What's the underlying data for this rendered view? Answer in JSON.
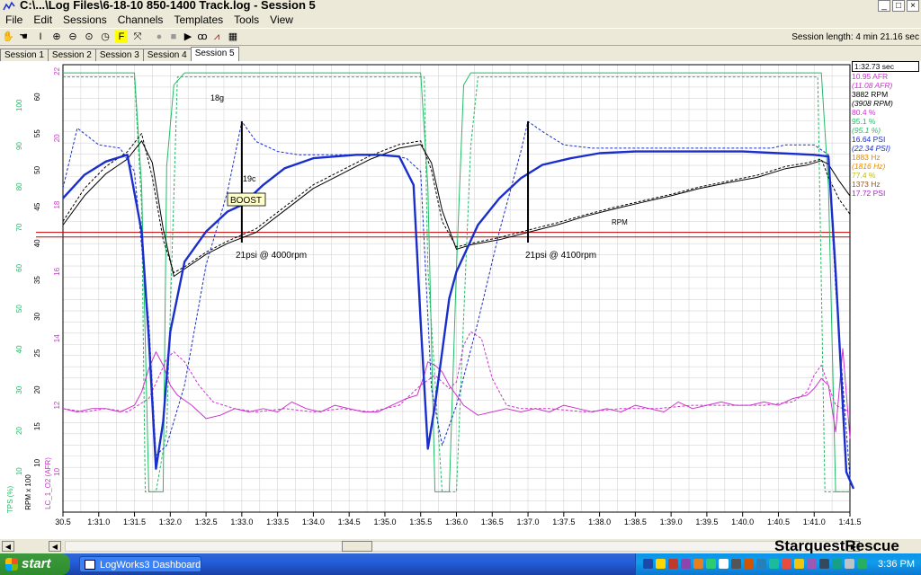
{
  "window": {
    "title": "C:\\...\\Log Files\\6-18-10 850-1400 Track.log - Session 5",
    "buttons": {
      "min": "_",
      "max": "□",
      "close": "×"
    }
  },
  "menu": [
    "File",
    "Edit",
    "Sessions",
    "Channels",
    "Templates",
    "Tools",
    "View"
  ],
  "toolbar": {
    "icons": [
      "hand-icon",
      "select-icon",
      "cursor-icon",
      "zoom-in-icon",
      "zoom-out-icon",
      "zoom-fit-icon",
      "clock-icon",
      "marker-icon",
      "measure-icon",
      "record-icon",
      "stop-icon",
      "play-icon",
      "binoculars-icon",
      "graph-icon",
      "table-icon"
    ],
    "session_length": "Session length:  4 min 21.16 sec"
  },
  "tabs": [
    "Session 1",
    "Session 2",
    "Session 3",
    "Session 4",
    "Session 5"
  ],
  "active_tab": 4,
  "legend": {
    "time": "1:32.73 sec",
    "rows": [
      {
        "text": "10.95 AFR",
        "color": "#cc33cc",
        "italic": false
      },
      {
        "text": "(11.08 AFR)",
        "color": "#cc33cc",
        "italic": true
      },
      {
        "text": "3882 RPM",
        "color": "#000000",
        "italic": false
      },
      {
        "text": "(3908 RPM)",
        "color": "#000000",
        "italic": true
      },
      {
        "text": "80.4 %",
        "color": "#cc33cc",
        "italic": false
      },
      {
        "text": "95.1 %",
        "color": "#22bb66",
        "italic": false
      },
      {
        "text": "(95.1 %)",
        "color": "#22bb66",
        "italic": true
      },
      {
        "text": "16.64 PSI",
        "color": "#1a2ecc",
        "italic": false
      },
      {
        "text": "(22.34 PSI)",
        "color": "#1a2ecc",
        "italic": true
      },
      {
        "text": "1883 Hz",
        "color": "#e08a00",
        "italic": false
      },
      {
        "text": "(1816 Hz)",
        "color": "#e08a00",
        "italic": true
      },
      {
        "text": "77.4 %",
        "color": "#bbbb22",
        "italic": false
      },
      {
        "text": "1373 Hz",
        "color": "#995522",
        "italic": false
      },
      {
        "text": "17.72 PSI",
        "color": "#aa22cc",
        "italic": false
      }
    ]
  },
  "chart_data": {
    "type": "line",
    "x_ticks": [
      "30.5",
      "1:31.0",
      "1:31.5",
      "1:32.0",
      "1:32.5",
      "1:33.0",
      "1:33.5",
      "1:34.0",
      "1:34.5",
      "1:35.0",
      "1:35.5",
      "1:36.0",
      "1:36.5",
      "1:37.0",
      "1:37.5",
      "1:38.0",
      "1:38.5",
      "1:39.0",
      "1:39.5",
      "1:40.0",
      "1:40.5",
      "1:41.0",
      "1:41.5"
    ],
    "axis_afr": {
      "label": "LC_1_O2 (AFR)",
      "color": "#cc33cc",
      "ticks": [
        "10",
        "12",
        "14",
        "16",
        "18",
        "20",
        "22"
      ]
    },
    "axis_rpm": {
      "label": "RPM x 100",
      "color": "#000000",
      "ticks": [
        "10",
        "15",
        "20",
        "25",
        "30",
        "35",
        "40",
        "45",
        "50",
        "55",
        "60"
      ]
    },
    "axis_tps": {
      "label": "TPS (%)",
      "color": "#22bb66",
      "ticks": [
        "10",
        "20",
        "30",
        "40",
        "50",
        "60",
        "70",
        "80",
        "90",
        "100"
      ]
    },
    "series": [
      {
        "key": "boost",
        "color": "#1a2ecc",
        "dash": false,
        "width": 2.4,
        "x": [
          30.5,
          30.8,
          31.1,
          31.4,
          31.6,
          31.7,
          31.8,
          31.9,
          32.0,
          32.2,
          32.5,
          32.8,
          33.0,
          33.3,
          33.6,
          34.0,
          34.3,
          34.6,
          34.9,
          35.2,
          35.4,
          35.5,
          35.6,
          35.7,
          35.8,
          35.9,
          36.0,
          36.3,
          36.6,
          36.9,
          37.2,
          37.6,
          38.0,
          38.5,
          39.0,
          39.5,
          40.0,
          40.5,
          41.0,
          41.2,
          41.3,
          41.45,
          41.55
        ],
        "y": [
          18.2,
          18.9,
          19.3,
          19.5,
          17.2,
          14.0,
          10.1,
          11.5,
          14.2,
          16.3,
          17.2,
          17.8,
          18.0,
          18.6,
          19.1,
          19.4,
          19.45,
          19.5,
          19.5,
          19.45,
          18.6,
          14.5,
          10.7,
          12.0,
          13.6,
          15.2,
          16.0,
          17.4,
          18.2,
          18.8,
          19.2,
          19.4,
          19.55,
          19.6,
          19.6,
          19.6,
          19.6,
          19.55,
          19.5,
          19.45,
          16.0,
          10.0,
          9.5
        ]
      },
      {
        "key": "boost-target",
        "color": "#1a2ecc",
        "dash": true,
        "width": 1,
        "x": [
          30.5,
          30.7,
          31.0,
          31.3,
          31.5,
          31.7,
          31.8,
          31.95,
          32.2,
          32.5,
          32.8,
          33.0,
          33.2,
          33.5,
          33.8,
          34.2,
          34.6,
          35.0,
          35.3,
          35.5,
          35.65,
          35.8,
          36.0,
          36.3,
          36.6,
          36.9,
          37.0,
          37.2,
          37.5,
          37.9,
          38.5,
          39.2,
          40.0,
          40.4,
          40.6,
          41.0,
          41.2,
          41.3,
          41.5
        ],
        "y": [
          18.5,
          20.3,
          19.8,
          19.7,
          19.0,
          14.5,
          10.5,
          10.8,
          12.6,
          16.2,
          18.4,
          20.5,
          19.9,
          19.6,
          19.5,
          19.5,
          19.5,
          19.5,
          19.4,
          19.0,
          12.5,
          10.8,
          12.0,
          14.5,
          17.2,
          19.6,
          20.5,
          20.2,
          19.8,
          19.7,
          19.7,
          19.7,
          19.7,
          19.7,
          19.8,
          19.8,
          19.5,
          15.5,
          9.8
        ]
      },
      {
        "key": "rpm",
        "color": "#000000",
        "dash": false,
        "width": 1,
        "x": [
          30.5,
          30.8,
          31.1,
          31.4,
          31.6,
          31.75,
          31.9,
          32.05,
          32.2,
          32.5,
          32.8,
          33.2,
          33.6,
          34.0,
          34.4,
          34.8,
          35.2,
          35.5,
          35.65,
          35.8,
          36.0,
          36.2,
          36.6,
          37.0,
          37.4,
          37.8,
          38.2,
          38.6,
          39.0,
          39.4,
          39.8,
          40.2,
          40.6,
          40.9,
          41.1,
          41.2,
          41.35,
          41.5
        ],
        "y": [
          42.5,
          46.5,
          49.5,
          51.5,
          54.0,
          51.0,
          42.0,
          35.5,
          36.5,
          38.5,
          40.0,
          41.5,
          44.5,
          47.5,
          49.5,
          51.5,
          53.0,
          53.5,
          51.0,
          44.5,
          39.2,
          39.8,
          40.5,
          41.5,
          42.5,
          43.7,
          44.7,
          45.6,
          46.5,
          47.5,
          48.3,
          49.0,
          50.2,
          50.7,
          51.3,
          50.8,
          48.5,
          46.5
        ]
      },
      {
        "key": "rpm-ref",
        "color": "#000000",
        "dash": true,
        "width": 1,
        "x": [
          30.5,
          30.8,
          31.1,
          31.4,
          31.6,
          31.75,
          31.9,
          32.05,
          32.2,
          32.5,
          32.8,
          33.2,
          33.6,
          34.0,
          34.4,
          34.8,
          35.2,
          35.5,
          35.65,
          35.8,
          36.0,
          36.2,
          36.6,
          37.0,
          37.4,
          37.8,
          38.2,
          38.6,
          39.0,
          39.4,
          39.8,
          40.2,
          40.6,
          40.9,
          41.1,
          41.2,
          41.35,
          41.5
        ],
        "y": [
          43.0,
          47.5,
          50.5,
          52.5,
          55.0,
          49.0,
          40.5,
          36.0,
          36.8,
          38.8,
          40.3,
          42.0,
          45.0,
          48.0,
          50.0,
          52.0,
          53.5,
          54.0,
          50.0,
          43.0,
          39.5,
          40.0,
          40.8,
          41.8,
          42.8,
          43.9,
          44.9,
          45.8,
          46.7,
          47.7,
          48.5,
          49.3,
          50.5,
          51.0,
          51.5,
          49.0,
          46.0,
          44.0
        ]
      },
      {
        "key": "tps",
        "color": "#22bb66",
        "dash": false,
        "width": 1,
        "x": [
          30.5,
          31.5,
          31.6,
          31.7,
          31.8,
          31.9,
          31.95,
          32.05,
          32.2,
          32.5,
          35.3,
          35.5,
          35.6,
          35.7,
          35.8,
          35.9,
          36.0,
          36.1,
          36.2,
          36.3,
          41.0,
          41.1,
          41.2,
          41.3,
          41.5
        ],
        "y": [
          108,
          108,
          80,
          5,
          5,
          5,
          85,
          105,
          108,
          108,
          108,
          108,
          80,
          5,
          5,
          5,
          60,
          105,
          108,
          108,
          108,
          108,
          80,
          5,
          5
        ]
      },
      {
        "key": "tps-ref",
        "color": "#22bb66",
        "dash": true,
        "width": 1,
        "x": [
          30.5,
          31.5,
          31.6,
          31.65,
          31.8,
          31.95,
          32.1,
          32.2,
          35.4,
          35.55,
          35.6,
          35.8,
          36.0,
          36.2,
          36.3,
          40.9,
          41.05,
          41.15,
          41.3,
          41.5
        ],
        "y": [
          107,
          107,
          75,
          5,
          5,
          20,
          107,
          107,
          107,
          107,
          60,
          5,
          5,
          90,
          107,
          107,
          107,
          5,
          5,
          5
        ]
      },
      {
        "key": "afr",
        "color": "#cc33cc",
        "dash": false,
        "width": 1,
        "x": [
          30.5,
          30.7,
          30.9,
          31.1,
          31.3,
          31.5,
          31.6,
          31.7,
          31.8,
          31.9,
          32.0,
          32.1,
          32.3,
          32.5,
          32.7,
          32.9,
          33.1,
          33.3,
          33.5,
          33.7,
          33.9,
          34.1,
          34.3,
          34.5,
          34.7,
          34.9,
          35.1,
          35.3,
          35.45,
          35.55,
          35.6,
          35.7,
          35.8,
          35.9,
          36.0,
          36.1,
          36.3,
          36.5,
          36.7,
          36.9,
          37.1,
          37.3,
          37.5,
          37.7,
          37.9,
          38.1,
          38.3,
          38.5,
          38.7,
          38.9,
          39.1,
          39.3,
          39.5,
          39.7,
          39.9,
          40.1,
          40.3,
          40.5,
          40.7,
          40.9,
          41.0,
          41.1,
          41.2,
          41.3,
          41.4,
          41.5
        ],
        "y": [
          11.9,
          11.8,
          11.9,
          11.9,
          11.8,
          12.0,
          12.4,
          13.1,
          13.6,
          13.2,
          12.6,
          12.3,
          12.0,
          11.6,
          11.7,
          11.9,
          11.8,
          11.9,
          11.8,
          12.1,
          11.9,
          11.8,
          12.0,
          11.9,
          11.8,
          11.8,
          12.0,
          12.2,
          12.3,
          12.9,
          13.3,
          13.2,
          13.0,
          12.6,
          12.3,
          12.0,
          11.7,
          11.8,
          11.9,
          11.8,
          11.9,
          11.8,
          12.0,
          11.9,
          11.8,
          11.9,
          11.8,
          12.0,
          11.9,
          11.8,
          12.1,
          11.9,
          12.0,
          12.1,
          12.0,
          12.0,
          12.1,
          12.0,
          12.2,
          12.3,
          12.5,
          12.8,
          12.6,
          11.2,
          13.7,
          11.0
        ]
      },
      {
        "key": "afr-ref",
        "color": "#cc33cc",
        "dash": true,
        "width": 1,
        "x": [
          30.5,
          30.8,
          31.1,
          31.4,
          31.7,
          31.85,
          31.95,
          32.05,
          32.2,
          32.4,
          32.6,
          32.9,
          33.2,
          33.6,
          34.0,
          34.4,
          34.8,
          35.2,
          35.5,
          35.7,
          35.9,
          36.0,
          36.1,
          36.2,
          36.35,
          36.5,
          36.7,
          36.9,
          37.3,
          37.8,
          38.3,
          38.8,
          39.3,
          39.8,
          40.3,
          40.7,
          40.9,
          41.0,
          41.1,
          41.2,
          41.3,
          41.5
        ],
        "y": [
          11.9,
          11.8,
          11.9,
          11.8,
          12.2,
          12.9,
          13.4,
          13.6,
          13.3,
          12.6,
          12.1,
          11.9,
          11.8,
          11.9,
          11.8,
          11.9,
          11.8,
          12.0,
          12.6,
          12.9,
          12.5,
          12.7,
          13.8,
          14.2,
          14.0,
          12.8,
          12.0,
          11.9,
          11.9,
          11.8,
          11.9,
          11.9,
          12.0,
          12.0,
          12.0,
          12.1,
          12.4,
          12.9,
          13.2,
          12.6,
          12.0,
          11.8
        ]
      }
    ],
    "reference_lines": [
      {
        "key": "target-line-upper",
        "y": 16.6,
        "color": "#cc0000"
      },
      {
        "key": "target-line-lower",
        "y": 16.35,
        "color": "#cc0000"
      }
    ],
    "markers": [
      {
        "key": "marker-1",
        "x": 33.0
      },
      {
        "key": "marker-2",
        "x": 37.0
      }
    ],
    "annotations": [
      {
        "key": "label-18g",
        "text": "18g"
      },
      {
        "key": "label-19c",
        "text": "19c"
      },
      {
        "key": "label-boost",
        "text": "BOOST"
      },
      {
        "key": "label-psi-1",
        "text": "21psi @ 4000rpm"
      },
      {
        "key": "label-psi-2",
        "text": "21psi @ 4100rpm"
      },
      {
        "key": "label-rpm",
        "text": "RPM"
      }
    ]
  },
  "watermark": "StarquestRescue",
  "taskbar": {
    "start": "start",
    "task": "LogWorks3 Dashboard",
    "clock": "3:36 PM"
  }
}
